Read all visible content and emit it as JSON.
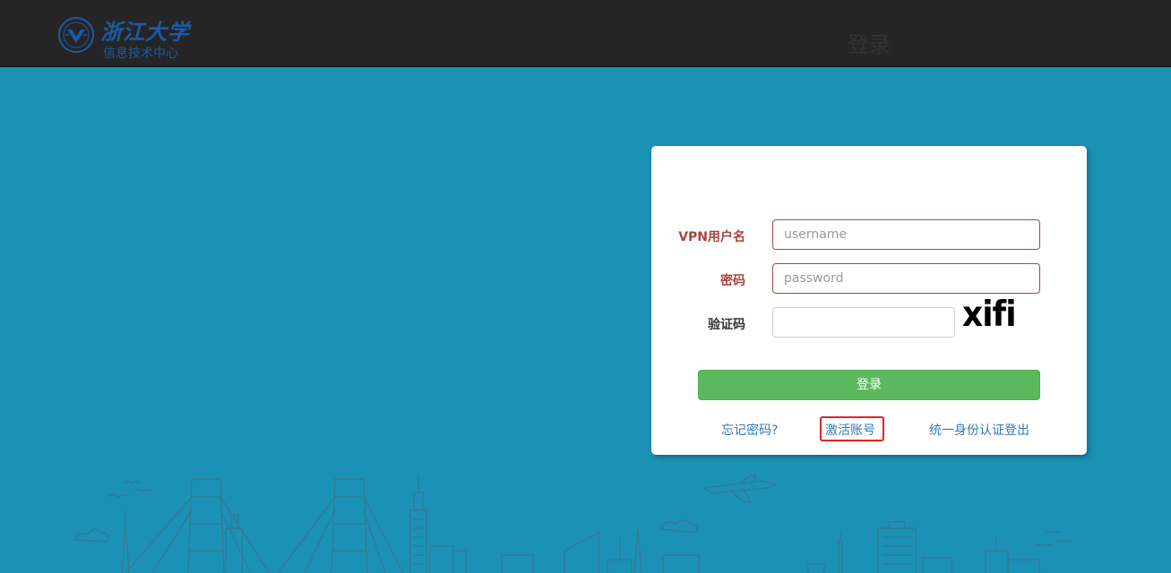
{
  "header": {
    "school_name": "浙江大学",
    "department": "信息技术中心"
  },
  "login": {
    "title": "登录",
    "username_label": "VPN用户名",
    "username_placeholder": "username",
    "username_value": "",
    "password_label": "密码",
    "password_placeholder": "password",
    "password_value": "",
    "captcha_label": "验证码",
    "captcha_value": "",
    "captcha_text": "xifi",
    "submit_label": "登录",
    "links": {
      "forgot_password": "忘记密码?",
      "activate_account": "激活账号",
      "sso_logout": "统一身份认证登出"
    }
  },
  "colors": {
    "background": "#1b91b6",
    "topbar": "#252525",
    "brand_blue": "#1d5aa6",
    "error_red": "#a94442",
    "success_green": "#5cb85c",
    "link_blue": "#337ab7",
    "highlight_red": "#e8221f"
  },
  "icons": {
    "emblem": "zju-emblem-icon",
    "skyline": "city-skyline-illustration"
  }
}
